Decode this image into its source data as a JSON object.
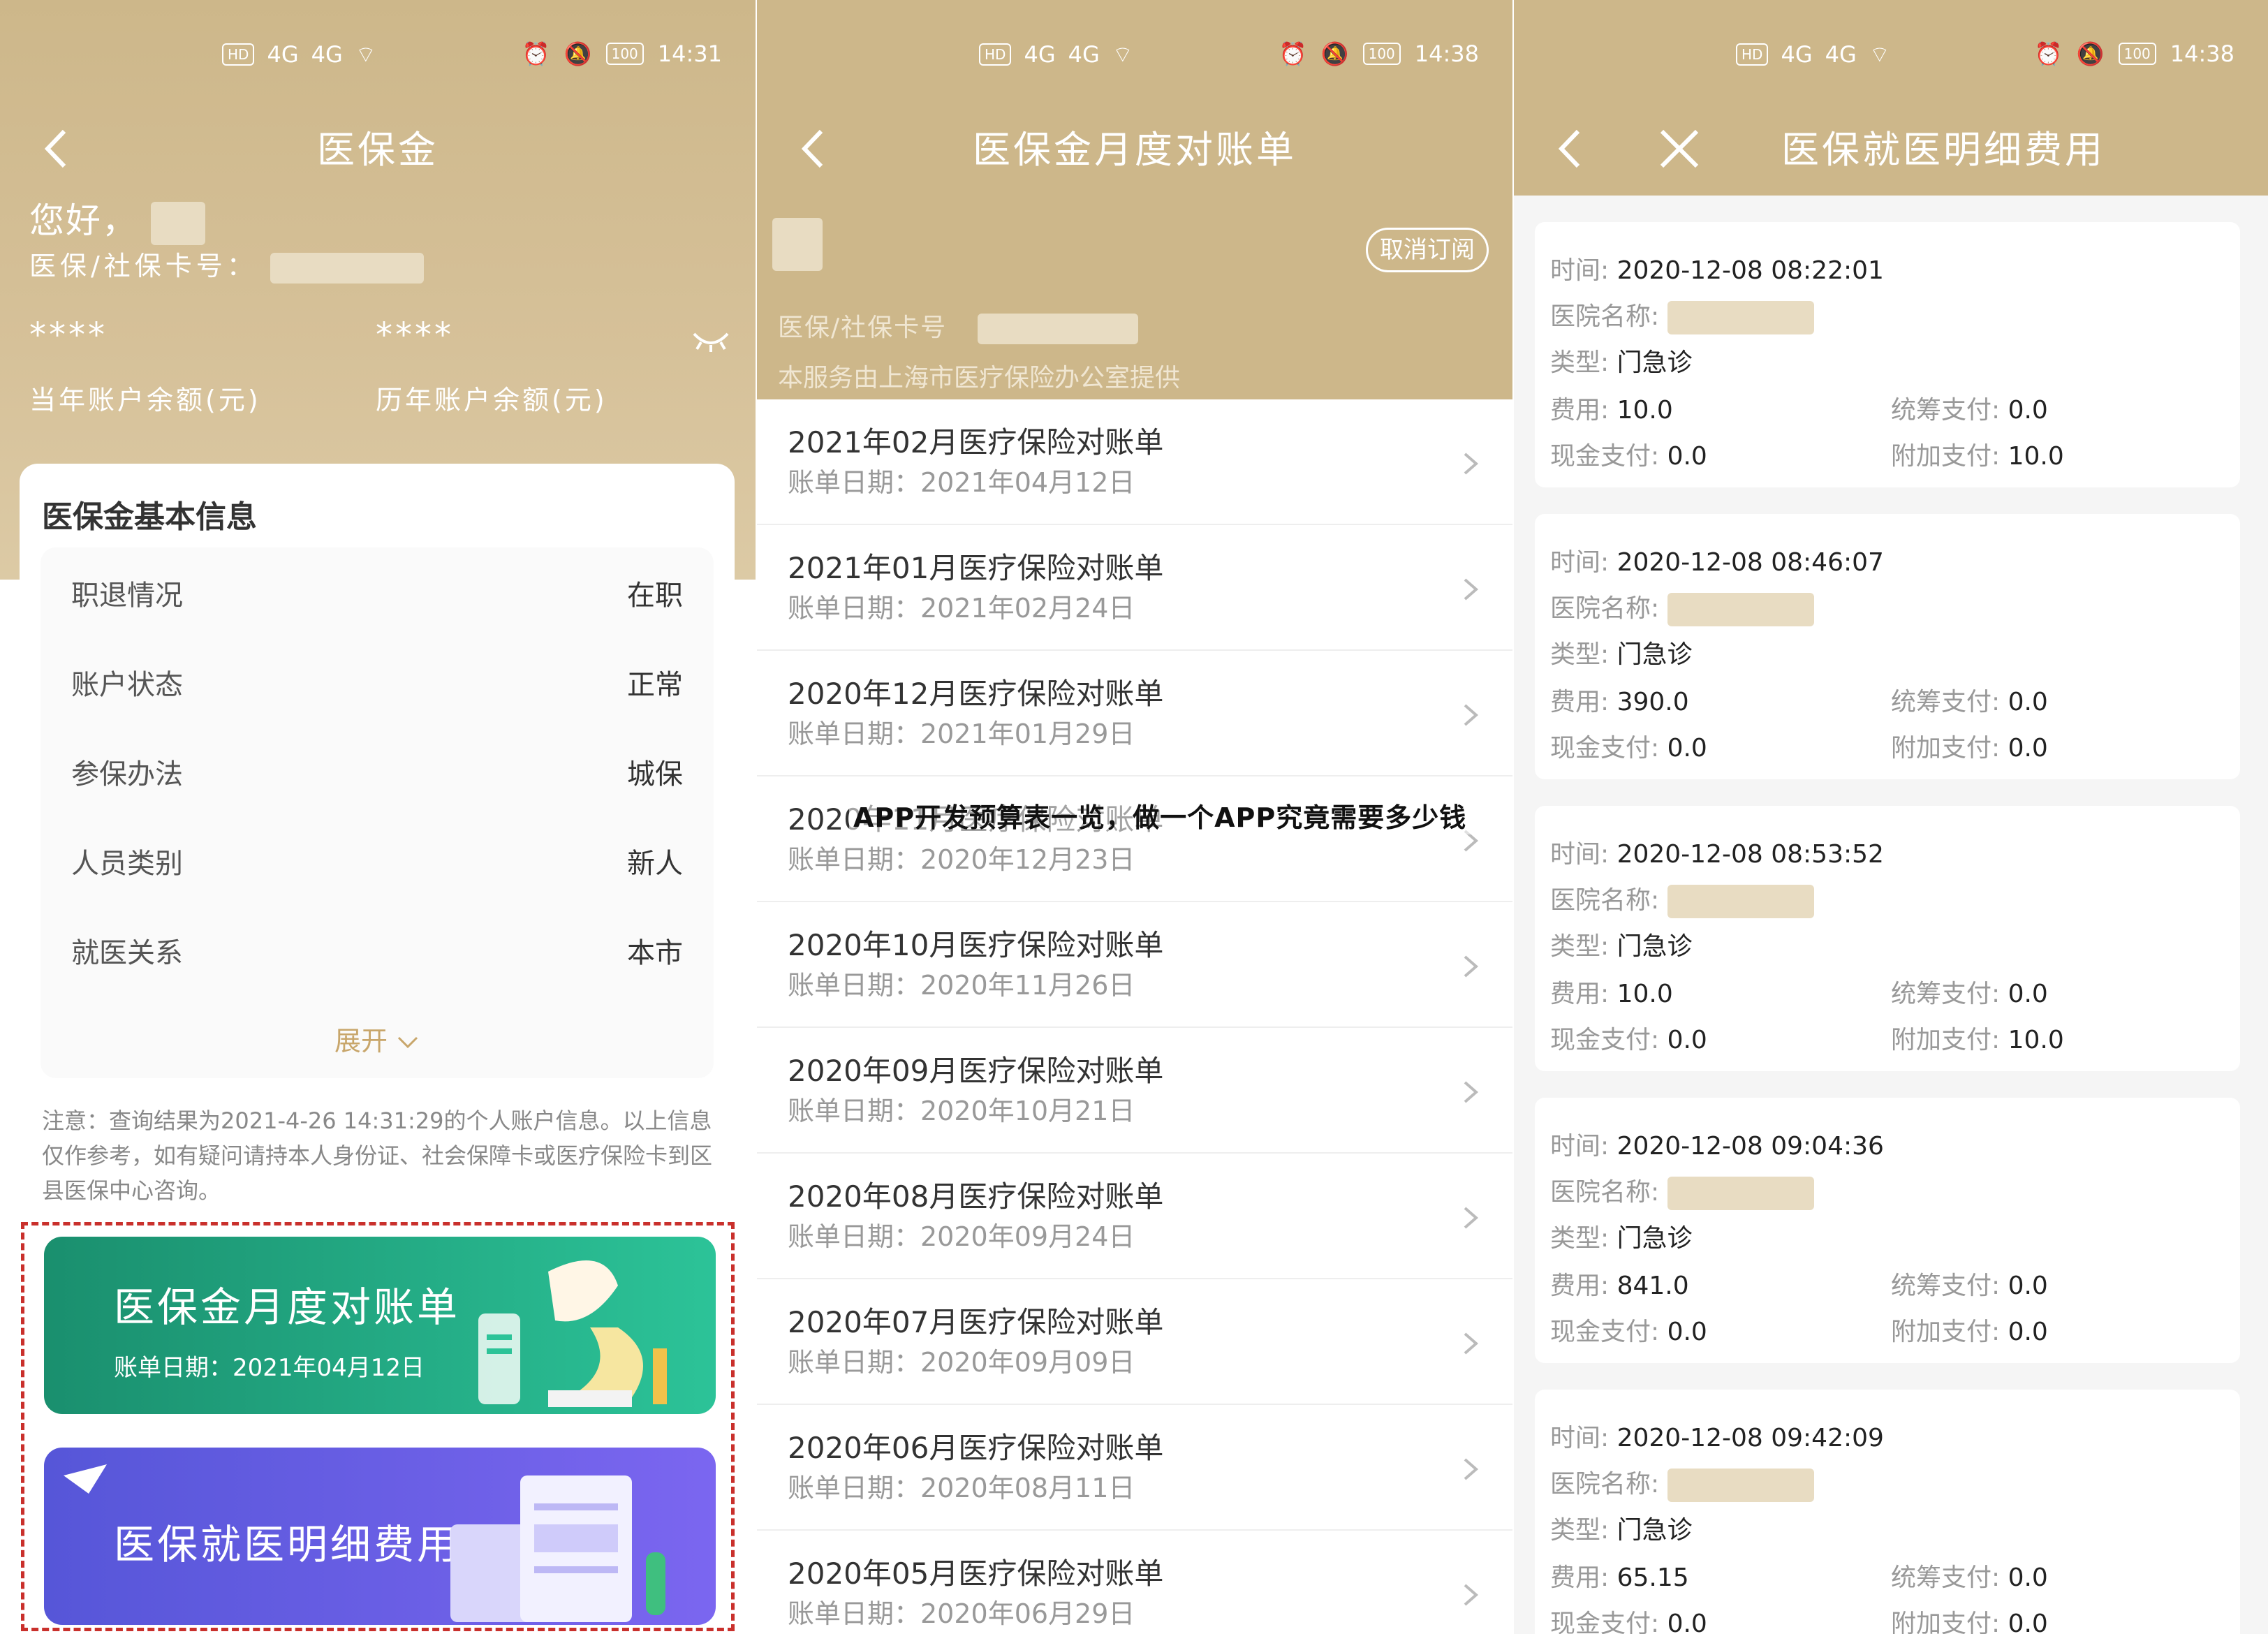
{
  "status_bar": [
    {
      "network": "HD",
      "signal_1": "4G",
      "signal_2": "4G",
      "battery": "100",
      "time": "14:31"
    },
    {
      "network": "HD",
      "signal_1": "4G",
      "signal_2": "4G",
      "battery": "100",
      "time": "14:38"
    },
    {
      "network": "HD",
      "signal_1": "4G",
      "signal_2": "4G",
      "battery": "100",
      "time": "14:38"
    }
  ],
  "panel1": {
    "nav_title": "医保金",
    "greeting": "您好，",
    "card_label": "医保/社保卡号：",
    "current_balance_value": "****",
    "current_balance_label": "当年账户余额(元)",
    "history_balance_value": "****",
    "history_balance_label": "历年账户余额(元)",
    "info_title": "医保金基本信息",
    "info_rows": [
      {
        "label": "职退情况",
        "value": "在职"
      },
      {
        "label": "账户状态",
        "value": "正常"
      },
      {
        "label": "参保办法",
        "value": "城保"
      },
      {
        "label": "人员类别",
        "value": "新人"
      },
      {
        "label": "就医关系",
        "value": "本市"
      }
    ],
    "expand_label": "展开",
    "note": "注意：查询结果为2021-4-26 14:31:29的个人账户信息。以上信息仅作参考，如有疑问请持本人身份证、社会保障卡或医疗保险卡到区县医保中心咨询。",
    "banner_statement_title": "医保金月度对账单",
    "banner_statement_sub": "账单日期：2021年04月12日",
    "banner_details_title": "医保就医明细费用"
  },
  "panel2": {
    "nav_title": "医保金月度对账单",
    "unsubscribe_label": "取消订阅",
    "card_label": "医保/社保卡号",
    "provider": "本服务由上海市医疗保险办公室提供",
    "bills": [
      {
        "title": "2021年02月医疗保险对账单",
        "date": "账单日期：2021年04月12日"
      },
      {
        "title": "2021年01月医疗保险对账单",
        "date": "账单日期：2021年02月24日"
      },
      {
        "title": "2020年12月医疗保险对账单",
        "date": "账单日期：2021年01月29日"
      },
      {
        "title": "2020年11月医疗保险对账单",
        "date": "账单日期：2020年12月23日"
      },
      {
        "title": "2020年10月医疗保险对账单",
        "date": "账单日期：2020年11月26日"
      },
      {
        "title": "2020年09月医疗保险对账单",
        "date": "账单日期：2020年10月21日"
      },
      {
        "title": "2020年08月医疗保险对账单",
        "date": "账单日期：2020年09月24日"
      },
      {
        "title": "2020年07月医疗保险对账单",
        "date": "账单日期：2020年09月09日"
      },
      {
        "title": "2020年06月医疗保险对账单",
        "date": "账单日期：2020年08月11日"
      },
      {
        "title": "2020年05月医疗保险对账单",
        "date": "账单日期：2020年06月29日"
      }
    ]
  },
  "panel3": {
    "nav_title": "医保就医明细费用",
    "labels": {
      "time": "时间: ",
      "hospital": "医院名称: ",
      "type": "类型: ",
      "fee": "费用: ",
      "pooled": "统筹支付: ",
      "cash": "现金支付: ",
      "extra": "附加支付: "
    },
    "records": [
      {
        "time": "2020-12-08 08:22:01",
        "type": "门急诊",
        "fee": "10.0",
        "pooled": "0.0",
        "cash": "0.0",
        "extra": "10.0"
      },
      {
        "time": "2020-12-08 08:46:07",
        "type": "门急诊",
        "fee": "390.0",
        "pooled": "0.0",
        "cash": "0.0",
        "extra": "0.0"
      },
      {
        "time": "2020-12-08 08:53:52",
        "type": "门急诊",
        "fee": "10.0",
        "pooled": "0.0",
        "cash": "0.0",
        "extra": "10.0"
      },
      {
        "time": "2020-12-08 09:04:36",
        "type": "门急诊",
        "fee": "841.0",
        "pooled": "0.0",
        "cash": "0.0",
        "extra": "0.0"
      },
      {
        "time": "2020-12-08 09:42:09",
        "type": "门急诊",
        "fee": "65.15",
        "pooled": "0.0",
        "cash": "0.0",
        "extra": "0.0"
      }
    ]
  },
  "overlay_caption": "APP开发预算表一览，做一个APP究竟需要多少钱",
  "colors": {
    "gold": "#cdb78a",
    "green": "#2cc398",
    "purple": "#6a5ee8",
    "dash_red": "#c9302c"
  }
}
